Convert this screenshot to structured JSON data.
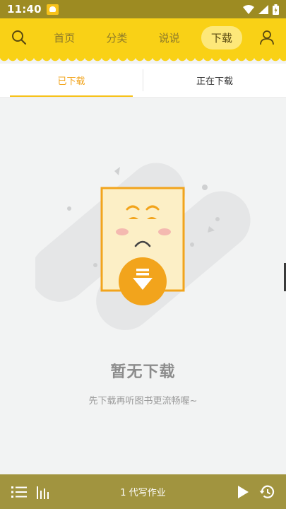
{
  "status_bar": {
    "time": "11:40"
  },
  "header": {
    "tabs": [
      {
        "label": "首页"
      },
      {
        "label": "分类"
      },
      {
        "label": "说说"
      },
      {
        "label": "下载"
      }
    ],
    "active_tab": "下载"
  },
  "sub_tabs": [
    {
      "label": "已下载"
    },
    {
      "label": "正在下载"
    }
  ],
  "empty_state": {
    "title": "暂无下载",
    "subtitle": "先下载再听图书更流畅喔~"
  },
  "player": {
    "title": "1 代写作业"
  },
  "colors": {
    "header": "#f9d116",
    "status_bar": "#9d8b22",
    "accent": "#f2a41c",
    "player_bar": "#a1943f"
  }
}
